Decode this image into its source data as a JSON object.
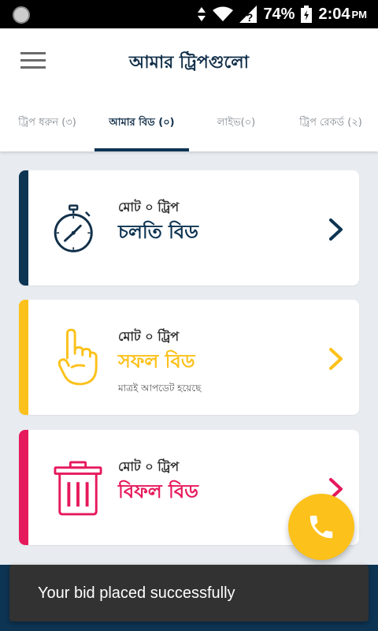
{
  "status_bar": {
    "battery_percent": "74%",
    "time": "2:04",
    "ampm": "PM",
    "icons": [
      "data-arrows-icon",
      "wifi-icon",
      "signal-unknown-icon",
      "battery-charging-icon"
    ]
  },
  "header": {
    "title": "আমার ট্রিপগুলো",
    "menu_icon": "hamburger-menu-icon"
  },
  "tabs": [
    {
      "label": "ট্রিপ ধরুন (৩)",
      "active": false
    },
    {
      "label": "আমার বিড (০)",
      "active": true
    },
    {
      "label": "লাইভ(০)",
      "active": false
    },
    {
      "label": "ট্রিপ রেকর্ড (২)",
      "active": false
    }
  ],
  "cards": [
    {
      "small": "মোট ০ ট্রিপ",
      "big": "চলতি বিড",
      "note": "",
      "color": "#0d3452",
      "icon": "stopwatch-icon"
    },
    {
      "small": "মোট ০ ট্রিপ",
      "big": "সফল বিড",
      "note": "মাত্রই আপডেট হয়েছে",
      "color": "#fcc11a",
      "icon": "pointing-hand-icon"
    },
    {
      "small": "মোট ০ ট্রিপ",
      "big": "বিফল বিড",
      "note": "",
      "color": "#e6195c",
      "icon": "trash-icon"
    }
  ],
  "fab": {
    "icon": "phone-icon",
    "color": "#fcc11a"
  },
  "snackbar": {
    "message": "Your bid placed successfully"
  }
}
